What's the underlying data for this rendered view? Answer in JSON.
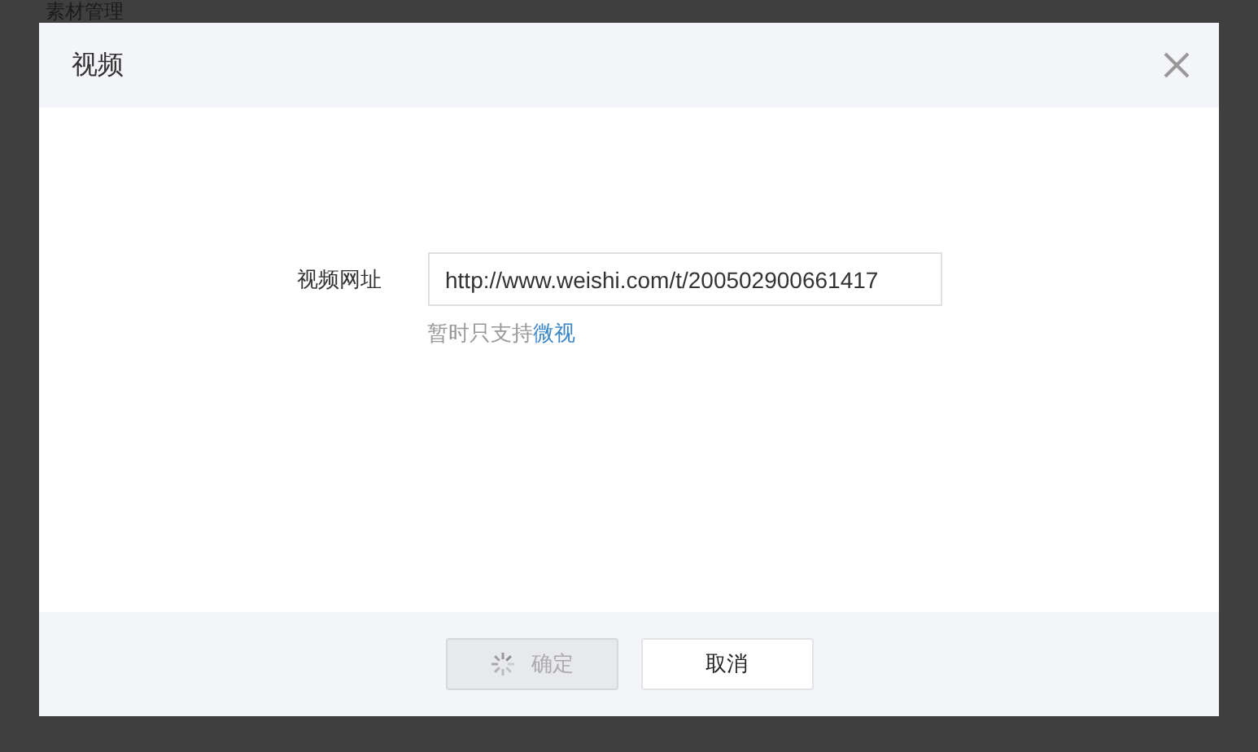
{
  "background_page": {
    "title": "素材管理"
  },
  "dialog": {
    "title": "视频",
    "field": {
      "label": "视频网址",
      "value": "http://www.weishi.com/t/200502900661417",
      "hint": "暂时只支持",
      "hint_link": "微视"
    },
    "buttons": [
      {
        "label": "确定",
        "disabled": true,
        "loading": true
      },
      {
        "label": "取消",
        "disabled": false,
        "loading": false
      }
    ]
  }
}
